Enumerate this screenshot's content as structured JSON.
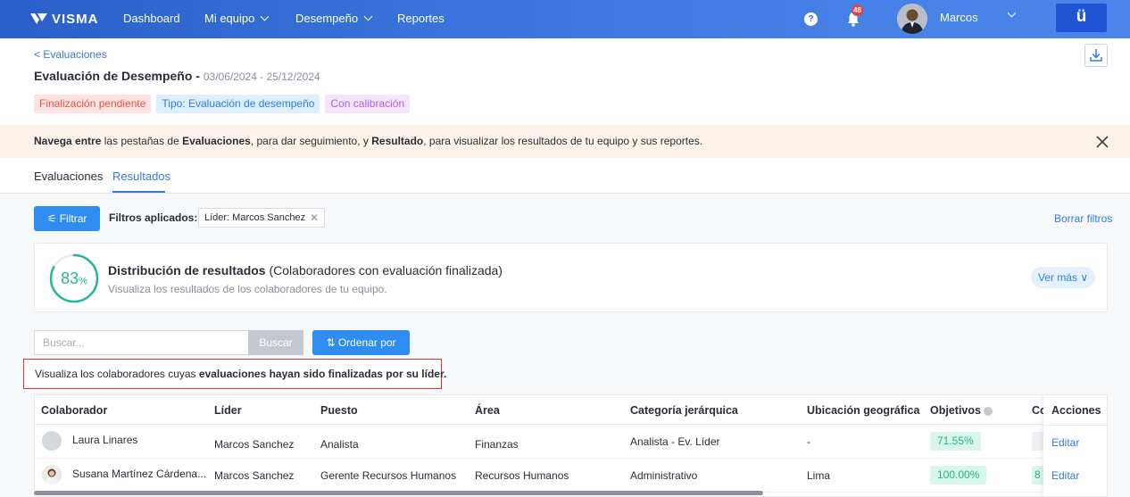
{
  "topbar": {
    "logo": "VISMA",
    "nav": [
      {
        "label": "Dashboard"
      },
      {
        "label": "Mi equipo"
      },
      {
        "label": "Desempeño"
      },
      {
        "label": "Reportes"
      }
    ],
    "notifications_count": "48",
    "user_name": "Marcos",
    "app_button": "ü",
    "help_icon": "?"
  },
  "header": {
    "back_link": "< Evaluaciones",
    "title": "Evaluación de Desempeño -",
    "dates": "03/06/2024 - 25/12/2024",
    "tags": [
      {
        "label": "Finalización pendiente",
        "color": "#e2574c"
      },
      {
        "label": "Tipo: Evaluación de desempeño",
        "color": "#2f7ee0"
      },
      {
        "label": "Con calibración",
        "color": "#b362da"
      }
    ]
  },
  "banner": {
    "part1": "Navega entre",
    "part2": " las pestañas de ",
    "part3": "Evaluaciones",
    "part4": ", para dar seguimiento, y ",
    "part5": "Resultado",
    "part6": ", para visualizar los resultados de tu equipo y sus reportes."
  },
  "tabs": [
    {
      "label": "Evaluaciones",
      "active": false
    },
    {
      "label": "Resultados",
      "active": true
    }
  ],
  "filters": {
    "button": "Filtrar",
    "applied_label": "Filtros aplicados:",
    "chip": "Líder: Marcos Sanchez",
    "clear": "Borrar filtros"
  },
  "distribution": {
    "percent": "83",
    "percent_unit": "%",
    "percent_value": 0.83,
    "title_bold": "Distribución de resultados",
    "title_rest": " (Colaboradores con evaluación finalizada)",
    "subtitle": "Visualiza los resultados de los colaboradores de tu equipo.",
    "more_button": "Ver más"
  },
  "search": {
    "placeholder": "Buscar...",
    "button": "Buscar",
    "sort_button": "Ordenar por"
  },
  "info": {
    "text_normal": "Visualiza los colaboradores cuyas ",
    "text_bold": "evaluaciones hayan sido finalizadas por su líder."
  },
  "table": {
    "headers": {
      "colaborador": "Colaborador",
      "lider": "Líder",
      "puesto": "Puesto",
      "area": "Área",
      "categoria": "Categoría jerárquica",
      "ubicacion": "Ubicación geográfica",
      "objetivos": "Objetivos",
      "co": "Co",
      "acciones": "Acciones"
    },
    "rows": [
      {
        "colaborador": "Laura Linares",
        "lider": "Marcos Sanchez",
        "puesto": "Analista",
        "area": "Finanzas",
        "categoria": "Analista - Ev. Líder",
        "ubicacion": "-",
        "objetivos": "71.55%",
        "co": "",
        "accion": "Editar"
      },
      {
        "colaborador": "Susana Martínez Cárdena...",
        "lider": "Marcos Sanchez",
        "puesto": "Gerente Recursos Humanos",
        "area": "Recursos Humanos",
        "categoria": "Administrativo",
        "ubicacion": "Lima",
        "objetivos": "100.00%",
        "co": "8",
        "accion": "Editar"
      }
    ]
  },
  "colors": {
    "accent": "#2f7ee0",
    "primary_button": "#2f8cf0",
    "topbar": "#3f7be3",
    "success": "#23b089",
    "danger": "#d9323a"
  }
}
